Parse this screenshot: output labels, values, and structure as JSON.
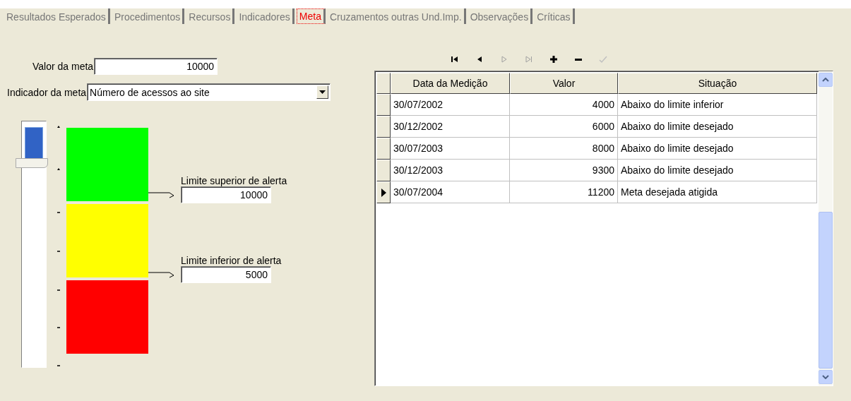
{
  "tabs": [
    {
      "label": "Resultados Esperados",
      "selected": false
    },
    {
      "label": "Procedimentos",
      "selected": false
    },
    {
      "label": "Recursos",
      "selected": false
    },
    {
      "label": "Indicadores",
      "selected": false
    },
    {
      "label": "Meta",
      "selected": true
    },
    {
      "label": "Cruzamentos outras Und.Imp.",
      "selected": false
    },
    {
      "label": "Observações",
      "selected": false
    },
    {
      "label": "Críticas",
      "selected": false
    }
  ],
  "goal_value": {
    "label": "Valor da meta",
    "value": "10000"
  },
  "goal_indicator": {
    "label": "Indicador da meta",
    "value": "Número de acessos ao site"
  },
  "gauge": {
    "level": 0.81,
    "bands": [
      {
        "color": "#00ff00"
      },
      {
        "color": "#ffff00"
      },
      {
        "color": "#ff0000"
      }
    ]
  },
  "upper_limit": {
    "label": "Limite superior de alerta",
    "value": "10000"
  },
  "lower_limit": {
    "label": "Limite inferior de alerta",
    "value": "5000"
  },
  "navigator": [
    {
      "kind": "first",
      "disabled": false
    },
    {
      "kind": "prior",
      "disabled": false
    },
    {
      "kind": "next",
      "disabled": true
    },
    {
      "kind": "last",
      "disabled": true
    },
    {
      "kind": "insert",
      "disabled": false
    },
    {
      "kind": "delete",
      "disabled": false
    },
    {
      "kind": "post",
      "disabled": true
    }
  ],
  "table": {
    "columns": [
      "Data da Medição",
      "Valor",
      "Situação"
    ],
    "rows": [
      {
        "cells": [
          "30/07/2002",
          "4000",
          "Abaixo do limite inferior"
        ],
        "selected": false
      },
      {
        "cells": [
          "30/12/2002",
          "6000",
          "Abaixo do limite desejado"
        ],
        "selected": false
      },
      {
        "cells": [
          "30/07/2003",
          "8000",
          "Abaixo do limite desejado"
        ],
        "selected": false
      },
      {
        "cells": [
          "30/12/2003",
          "9300",
          "Abaixo do limite desejado"
        ],
        "selected": false
      },
      {
        "cells": [
          "30/07/2004",
          "11200",
          "Meta desejada atigida"
        ],
        "selected": true
      }
    ]
  }
}
